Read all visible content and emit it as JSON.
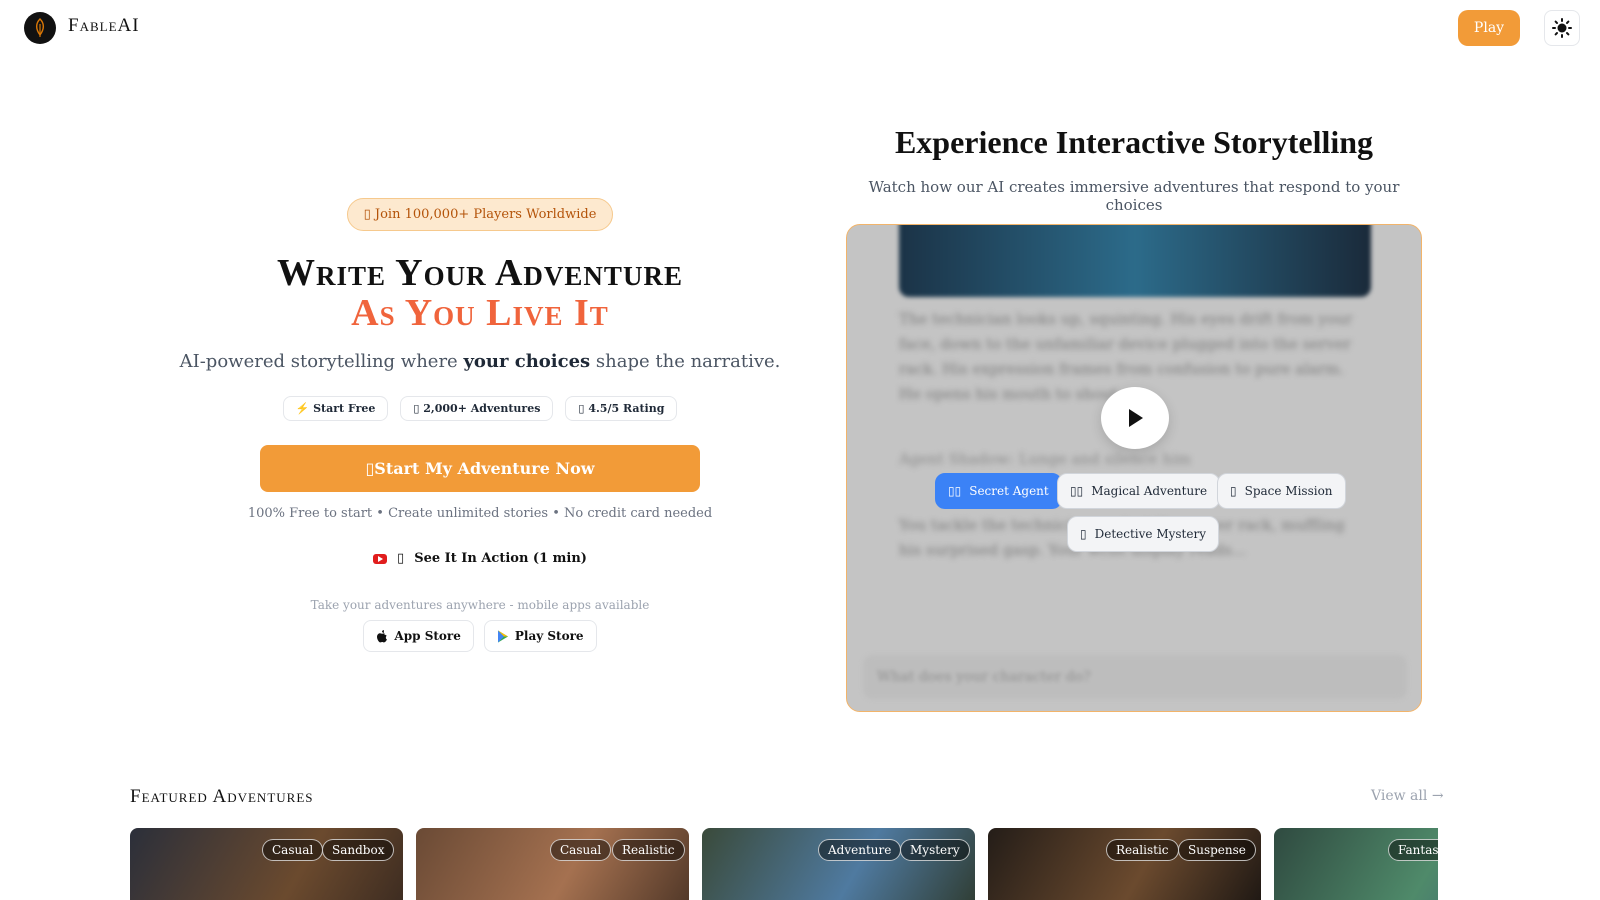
{
  "header": {
    "brand": "FableAI",
    "play_label": "Play",
    "logo_icon": "quill-pen-icon",
    "theme_icon": "sun-icon"
  },
  "hero": {
    "badge": "Join 100,000+ Players Worldwide",
    "headline_line1": "Write Your Adventure",
    "headline_line2": "As You Live It",
    "subline_prefix": "AI-powered storytelling where ",
    "subline_bold": "your choices",
    "subline_suffix": " shape the narrative.",
    "pills": [
      "⚡ Start Free",
      "2,000+ Adventures",
      "4.5/5 Rating"
    ],
    "cta_label": "Start My Adventure Now",
    "cta_note": "100% Free to start • Create unlimited stories • No credit card needed",
    "see_action": "See It In Action (1 min)",
    "mobile_note": "Take your adventures anywhere - mobile apps available",
    "app_store": "App Store",
    "play_store": "Play Store"
  },
  "demo": {
    "title": "Experience Interactive Storytelling",
    "subtitle": "Watch how our AI creates immersive adventures that respond to your choices",
    "story_text_1": "The technician looks up, squinting. His eyes drift from your face, down to the unfamiliar device plugged into the server rack. His expression frames from confusion to pure alarm. He opens his mouth to shout.",
    "story_action": "Agent Shadow: Lunge and silence him",
    "story_text_2": "You tackle the technician against the server rack, muffling his surprised gasp. Your wrist display reads...",
    "input_placeholder": "What does your character do?",
    "chips": [
      "Secret Agent",
      "Magical Adventure",
      "Space Mission",
      "Detective Mystery"
    ]
  },
  "featured": {
    "title": "Featured Adventures",
    "view_all": "View all →",
    "cards": [
      {
        "tags": [
          "Casual",
          "Sandbox"
        ]
      },
      {
        "tags": [
          "Casual",
          "Realistic"
        ]
      },
      {
        "tags": [
          "Adventure",
          "Mystery"
        ]
      },
      {
        "tags": [
          "Realistic",
          "Suspense"
        ]
      },
      {
        "tags": [
          "Fantasy"
        ]
      }
    ]
  },
  "colors": {
    "accent": "#f29b38",
    "headline_accent": "#f0643c",
    "chip_active": "#3b82f6"
  }
}
